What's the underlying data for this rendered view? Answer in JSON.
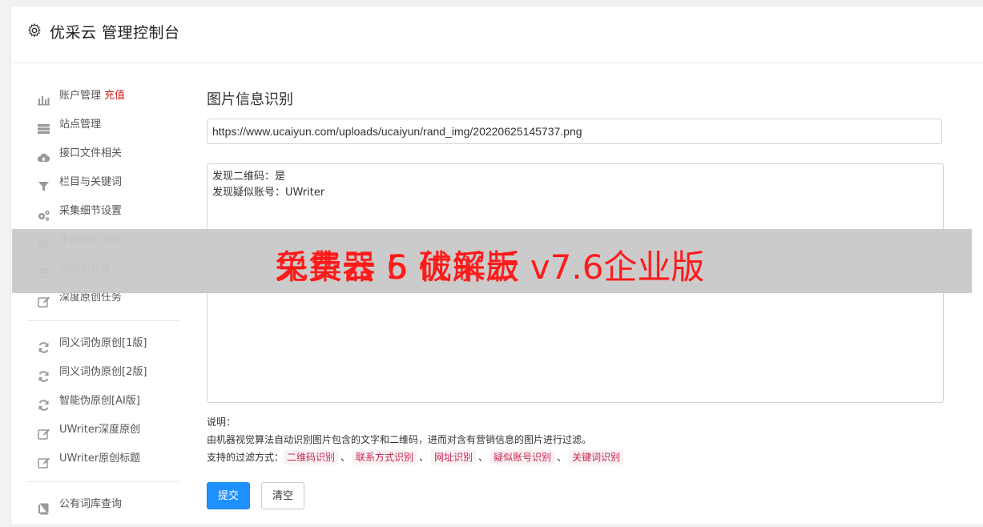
{
  "app": {
    "title": "优采云 管理控制台"
  },
  "sidebar": {
    "group1": [
      {
        "icon": "bar-chart-icon",
        "label": "账户管理",
        "badge": "充值"
      },
      {
        "icon": "server-icon",
        "label": "站点管理"
      },
      {
        "icon": "cloud-upload-icon",
        "label": "接口文件相关"
      },
      {
        "icon": "filter-icon",
        "label": "栏目与关键词"
      },
      {
        "icon": "cogs-icon",
        "label": "采集细节设置"
      },
      {
        "icon": "play-circle-icon",
        "label": "手动运行测试"
      },
      {
        "icon": "database-icon",
        "label": "文章暂存库"
      },
      {
        "icon": "edit-icon",
        "label": "深度原创任务"
      }
    ],
    "group2": [
      {
        "icon": "refresh-icon",
        "label": "同义词伪原创[1版]"
      },
      {
        "icon": "refresh-icon",
        "label": "同义词伪原创[2版]"
      },
      {
        "icon": "refresh-icon",
        "label": "智能伪原创[AI版]"
      },
      {
        "icon": "edit-icon",
        "label": "UWriter深度原创"
      },
      {
        "icon": "edit-icon",
        "label": "UWriter原创标题"
      }
    ],
    "group3": [
      {
        "icon": "book-icon",
        "label": "公有词库查询"
      }
    ]
  },
  "main": {
    "title": "图片信息识别",
    "url_value": "https://www.ucaiyun.com/uploads/ucaiyun/rand_img/20220625145737.png",
    "result_lines": [
      "发现二维码：是",
      "发现疑似账号：UWriter"
    ],
    "notes": {
      "heading": "说明：",
      "description": "由机器视觉算法自动识别图片包含的文字和二维码，进而对含有营销信息的图片进行过滤。",
      "filters_label": "支持的过滤方式：",
      "filters": [
        "二维码识别",
        "联系方式识别",
        "网址识别",
        "疑似账号识别",
        "关键词识别"
      ],
      "separator": "、"
    },
    "buttons": {
      "submit": "提交",
      "clear": "清空"
    }
  },
  "overlay": {
    "text_a": "采集器 5 破解版",
    "text_b": "免费云 6 优采云 v7.6企业版"
  },
  "colors": {
    "primary": "#1e90ff",
    "badge_red": "#e02020",
    "tag_red": "#c7254e",
    "overlay_text": "#ff1a1a"
  }
}
